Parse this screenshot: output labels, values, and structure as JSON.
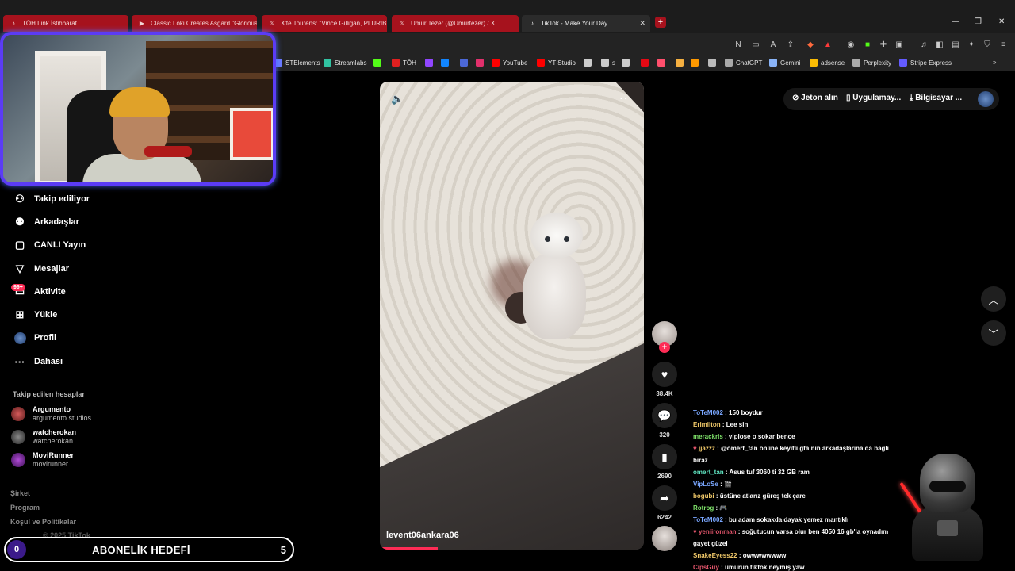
{
  "tabs": [
    {
      "label": "TÖH Link İstihbarat",
      "icon": "tiktok-red-icon"
    },
    {
      "label": "Classic Loki Creates Asgard \"Glorious",
      "icon": "youtube-icon"
    },
    {
      "label": "X'te Tourens: \"Vince Gilligan, PLURIBU",
      "icon": "x-icon"
    },
    {
      "label": "Umur Tezer (@Umurtezer) / X",
      "icon": "x-icon"
    },
    {
      "label": "TikTok - Make Your Day",
      "icon": "tiktok-icon"
    }
  ],
  "bookmarks": [
    {
      "label": "STElements",
      "color": "#6b7bff"
    },
    {
      "label": "Streamlabs",
      "color": "#31c3a2"
    },
    {
      "label": "",
      "color": "#53fc18"
    },
    {
      "label": "TÖH",
      "color": "#e02020"
    },
    {
      "label": "",
      "color": "#9146ff"
    },
    {
      "label": "",
      "color": "#1185fe"
    },
    {
      "label": "",
      "color": "#4c68d7"
    },
    {
      "label": "",
      "color": "#e1306c"
    },
    {
      "label": "YouTube",
      "color": "#ff0000"
    },
    {
      "label": "YT Studio",
      "color": "#ff0000"
    },
    {
      "label": "",
      "color": "#cccccc"
    },
    {
      "label": "s",
      "color": "#cccccc"
    },
    {
      "label": "",
      "color": "#cccccc"
    },
    {
      "label": "",
      "color": "#e50914"
    },
    {
      "label": "",
      "color": "#ff4f6d"
    },
    {
      "label": "",
      "color": "#f5b041"
    },
    {
      "label": "",
      "color": "#ff9900"
    },
    {
      "label": "",
      "color": "#bbbbbb"
    },
    {
      "label": "ChatGPT",
      "color": "#aaaaaa"
    },
    {
      "label": "Gemini",
      "color": "#8ab4f8"
    },
    {
      "label": "adsense",
      "color": "#fbbc04"
    },
    {
      "label": "Perplexity",
      "color": "#aaaaaa"
    },
    {
      "label": "Stripe Express",
      "color": "#635bff"
    }
  ],
  "sidebar": {
    "items": [
      {
        "label": "Takip ediliyor",
        "icon": "following-icon"
      },
      {
        "label": "Arkadaşlar",
        "icon": "friends-icon"
      },
      {
        "label": "CANLI Yayın",
        "icon": "live-icon"
      },
      {
        "label": "Mesajlar",
        "icon": "messages-icon"
      },
      {
        "label": "Aktivite",
        "icon": "activity-icon"
      },
      {
        "label": "Yükle",
        "icon": "upload-icon"
      },
      {
        "label": "Profil",
        "icon": "profile-icon"
      },
      {
        "label": "Dahası",
        "icon": "more-icon"
      }
    ],
    "activity_badge": "99+",
    "following_title": "Takip edilen hesaplar",
    "accounts": [
      {
        "name": "Argumento",
        "handle": "argumento.studios"
      },
      {
        "name": "watcherokan",
        "handle": "watcherokan"
      },
      {
        "name": "MoviRunner",
        "handle": "movirunner"
      }
    ],
    "footer": [
      "Şirket",
      "Program",
      "Koşul ve Politikalar"
    ],
    "footer_partial": "© 2025 TikTok"
  },
  "sub_goal": {
    "current": "0",
    "title": "ABONELİK HEDEFİ",
    "target": "5"
  },
  "video": {
    "creator": "levent06ankara06",
    "progress": 0.22
  },
  "actions": {
    "likes": "38.4K",
    "comments": "320",
    "saves": "2690",
    "shares": "6242"
  },
  "top_right": {
    "coins": "Jeton alın",
    "app": "Uygulamay...",
    "pc": "Bilgisayar ..."
  },
  "chat": [
    {
      "user": "ToTeM002",
      "color": "#7aa7ff",
      "text": "150 boydur"
    },
    {
      "user": "Erimilton",
      "color": "#f0c869",
      "text": "Lee sin"
    },
    {
      "user": "merackris",
      "color": "#7fe36a",
      "text": "viplose o sokar bence"
    },
    {
      "user": "jjazzz",
      "color": "#f0c869",
      "text": "@omert_tan online keyifli gta nın arkadaşlarına da bağlı biraz",
      "mod": true
    },
    {
      "user": "omert_tan",
      "color": "#5fe3c0",
      "text": "Asus tuf 3060 ti 32 GB ram"
    },
    {
      "user": "VipLoSe",
      "color": "#7aa7ff",
      "text": "🎬"
    },
    {
      "user": "bogubi",
      "color": "#f0c869",
      "text": "üstüne atlarız güreş tek çare"
    },
    {
      "user": "Rotrog",
      "color": "#7fe36a",
      "text": "🎮"
    },
    {
      "user": "ToTeM002",
      "color": "#7aa7ff",
      "text": "bu adam sokakda dayak yemez mantıklı"
    },
    {
      "user": "yeniironman",
      "color": "#e0546a",
      "text": "soğutucun varsa olur ben 4050 16 gb'la oynadım gayet güzel",
      "mod": true
    },
    {
      "user": "SnakeEyess22",
      "color": "#f0c869",
      "text": "owwwwwwww"
    },
    {
      "user": "CipsGuy",
      "color": "#e0546a",
      "text": "umurun tiktok neymiş yaw"
    }
  ]
}
